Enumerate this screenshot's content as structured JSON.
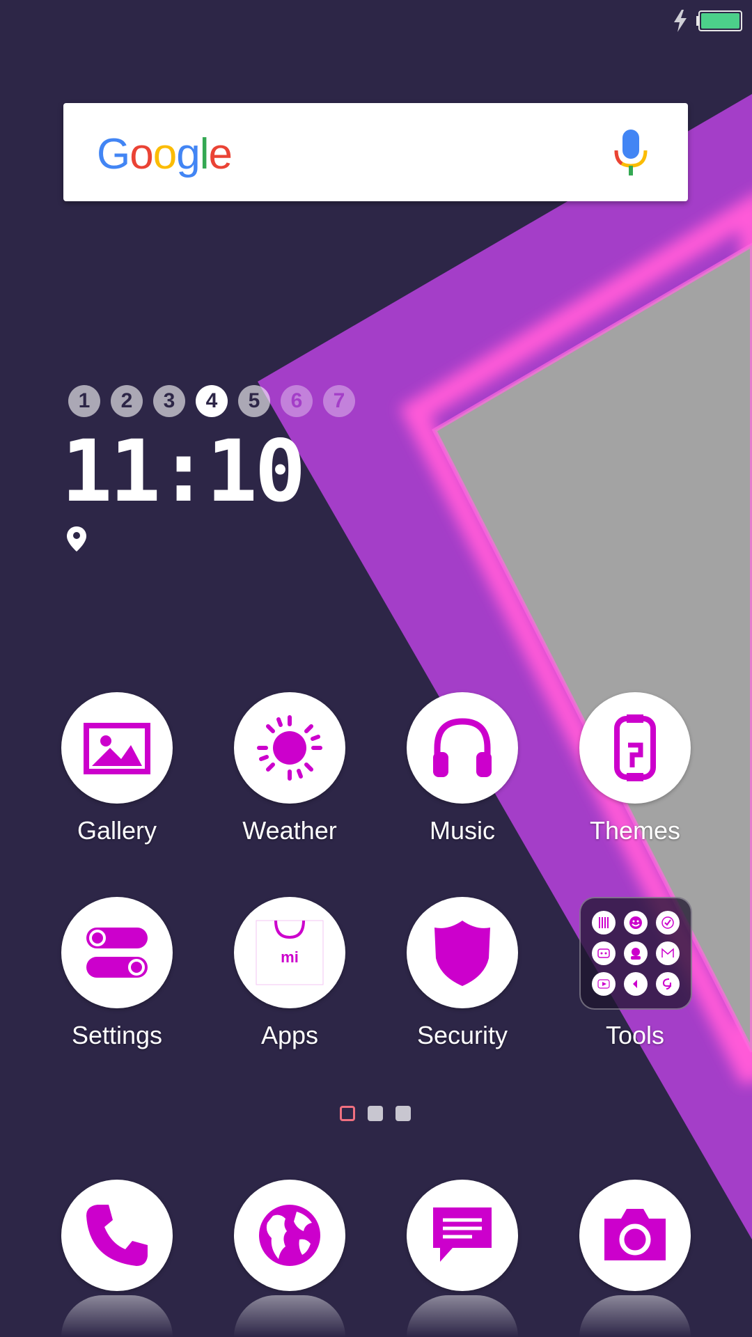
{
  "status_bar": {
    "battery_level": 1.0,
    "charging": true,
    "battery_color": "#4cd08a"
  },
  "search_widget": {
    "logo_letters": [
      {
        "char": "G",
        "color": "#4285F4"
      },
      {
        "char": "o",
        "color": "#EA4335"
      },
      {
        "char": "o",
        "color": "#FBBC05"
      },
      {
        "char": "g",
        "color": "#4285F4"
      },
      {
        "char": "l",
        "color": "#34A853"
      },
      {
        "char": "e",
        "color": "#EA4335"
      }
    ],
    "mic_icon": "mic-icon"
  },
  "clock_widget": {
    "days": [
      "1",
      "2",
      "3",
      "4",
      "5",
      "6",
      "7"
    ],
    "active_day": "4",
    "time": "11:10",
    "location_icon": "location-pin-icon"
  },
  "apps": [
    {
      "label": "Gallery",
      "icon": "gallery-icon"
    },
    {
      "label": "Weather",
      "icon": "sun-icon"
    },
    {
      "label": "Music",
      "icon": "headphones-icon"
    },
    {
      "label": "Themes",
      "icon": "themes-icon"
    },
    {
      "label": "Settings",
      "icon": "toggles-icon"
    },
    {
      "label": "Apps",
      "icon": "mi-bag-icon"
    },
    {
      "label": "Security",
      "icon": "shield-icon"
    },
    {
      "label": "Tools",
      "icon": "folder-icon"
    }
  ],
  "page_indicator": {
    "count": 3,
    "current": 1,
    "current_color": "#f07080",
    "other_color": "#c8c6d0"
  },
  "dock": [
    {
      "icon": "phone-icon"
    },
    {
      "icon": "globe-icon"
    },
    {
      "icon": "message-icon"
    },
    {
      "icon": "camera-icon"
    }
  ],
  "colors": {
    "accent": "#cc00cc",
    "background": "#2d2647",
    "stripe": "#a43ec8",
    "glow": "#ff5ad8",
    "panel": "#a3a3a3"
  }
}
